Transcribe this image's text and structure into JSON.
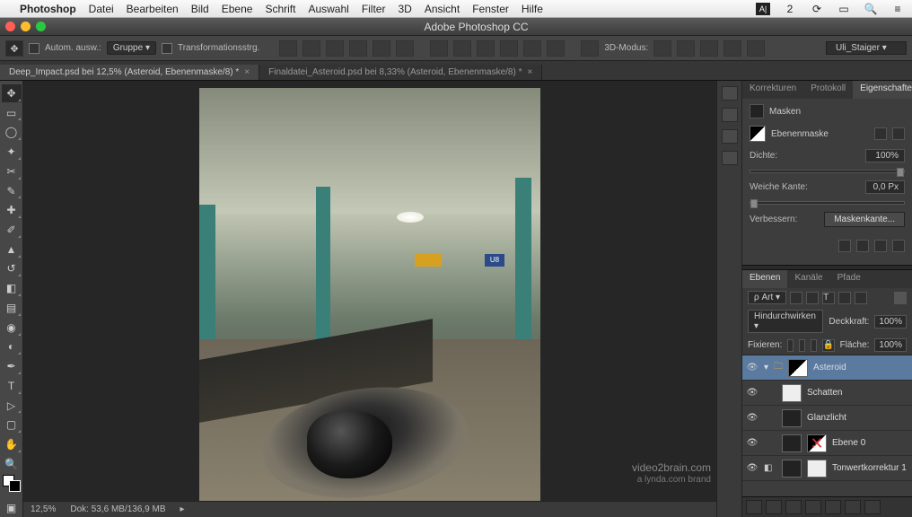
{
  "mac_menu": {
    "app": "Photoshop",
    "items": [
      "Datei",
      "Bearbeiten",
      "Bild",
      "Ebene",
      "Schrift",
      "Auswahl",
      "Filter",
      "3D",
      "Ansicht",
      "Fenster",
      "Hilfe"
    ],
    "right_icons": [
      "adobe-icon",
      "notify-icon",
      "battery-icon",
      "spotlight-icon",
      "menu-icon"
    ],
    "notify_badge": "2"
  },
  "window_title": "Adobe Photoshop CC",
  "options_bar": {
    "auto_select_label": "Autom. ausw.:",
    "auto_select_mode": "Gruppe",
    "transform_label": "Transformationsstrg.",
    "mode_label": "3D-Modus:",
    "workspace": "Uli_Staiger"
  },
  "tabs": [
    {
      "label": "Deep_Impact.psd bei 12,5% (Asteroid, Ebenenmaske/8) *",
      "active": true
    },
    {
      "label": "Finaldatei_Asteroid.psd bei 8,33% (Asteroid, Ebenenmaske/8) *",
      "active": false
    }
  ],
  "status": {
    "zoom": "12,5%",
    "doc": "Dok: 53,6 MB/136,9 MB"
  },
  "canvas": {
    "sign_u8": "U8"
  },
  "properties": {
    "tabs": [
      "Korrekturen",
      "Protokoll",
      "Eigenschaften"
    ],
    "active_tab": 2,
    "section": "Masken",
    "mask_name": "Ebenenmaske",
    "density_label": "Dichte:",
    "density_value": "100%",
    "feather_label": "Weiche Kante:",
    "feather_value": "0,0 Px",
    "refine_label": "Verbessern:",
    "refine_button": "Maskenkante..."
  },
  "layers_panel": {
    "tabs": [
      "Ebenen",
      "Kanäle",
      "Pfade"
    ],
    "active_tab": 0,
    "filter_label": "Art",
    "blend_mode": "Hindurchwirken",
    "opacity_label": "Deckkraft:",
    "opacity_value": "100%",
    "lock_label": "Fixieren:",
    "fill_label": "Fläche:",
    "fill_value": "100%",
    "layers": [
      {
        "name": "Asteroid",
        "type": "group",
        "selected": true
      },
      {
        "name": "Schatten",
        "type": "layer"
      },
      {
        "name": "Glanzlicht",
        "type": "layer"
      },
      {
        "name": "Ebene 0",
        "type": "layer"
      },
      {
        "name": "Tonwertkorrektur 1",
        "type": "adjustment"
      }
    ]
  },
  "watermark": {
    "line1": "video2brain.com",
    "line2": "a lynda.com brand"
  }
}
